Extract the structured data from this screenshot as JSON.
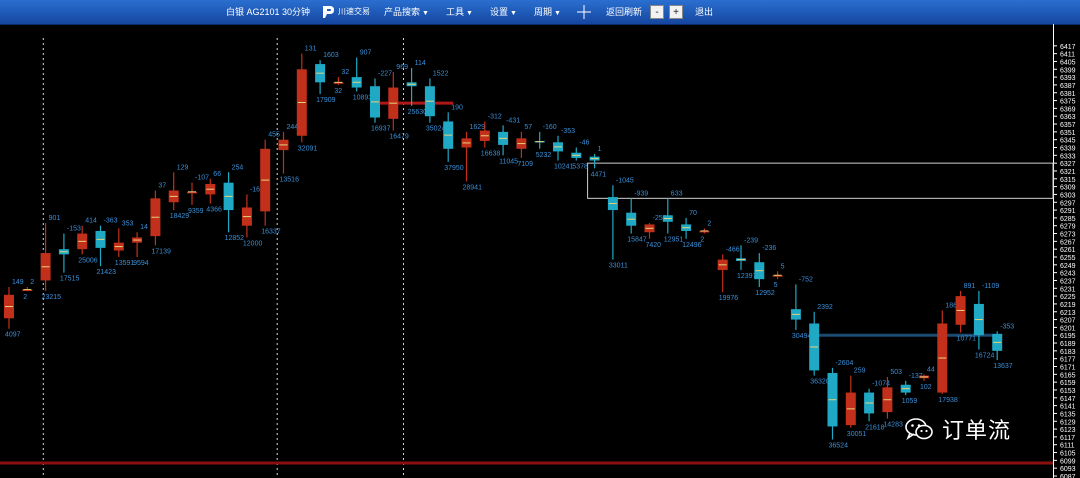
{
  "toolbar": {
    "title": "白银 AG2101 30分钟",
    "logo_text": "川速交易",
    "product_search": "产品搜索",
    "tools": "工具",
    "settings": "设置",
    "period": "周期",
    "back_refresh": "返回刷新",
    "minus_label": "-",
    "plus_label": "+",
    "exit": "退出",
    "icons": {
      "dropdown": "chevron-down-icon",
      "crosshair": "crosshair-icon",
      "logo": "logo-icon"
    }
  },
  "watermark": {
    "text": "订单流",
    "icon": "wechat-icon"
  },
  "colors": {
    "background": "#000000",
    "toolbar": "#1f5cc0",
    "up_candle": "#c2301c",
    "down_candle": "#1fa9c4",
    "label": "#3a8fd8",
    "guide": "#8a1010"
  },
  "chart_data": {
    "type": "candlestick",
    "symbol": "AG2101",
    "period": "30分钟",
    "ylim": [
      6087,
      6423
    ],
    "y_ticks": [
      6417,
      6411,
      6405,
      6399,
      6393,
      6387,
      6381,
      6375,
      6369,
      6363,
      6357,
      6351,
      6345,
      6339,
      6333,
      6327,
      6321,
      6315,
      6309,
      6303,
      6297,
      6291,
      6285,
      6279,
      6273,
      6267,
      6261,
      6255,
      6249,
      6243,
      6237,
      6231,
      6225,
      6219,
      6213,
      6207,
      6201,
      6195,
      6189,
      6183,
      6177,
      6171,
      6165,
      6159,
      6153,
      6147,
      6141,
      6135,
      6129,
      6123,
      6117,
      6111,
      6105,
      6099,
      6093,
      6087
    ],
    "session_separators": [
      1,
      14,
      15
    ],
    "candles": [
      {
        "o": 6208,
        "h": 6232,
        "l": 6200,
        "c": 6226,
        "delta": "149",
        "vol": "4097"
      },
      {
        "o": 6230,
        "h": 6232,
        "l": 6229,
        "c": 6230,
        "delta": "2",
        "vol": "2"
      },
      {
        "o": 6237,
        "h": 6281,
        "l": 6229,
        "c": 6258,
        "delta": "901",
        "vol": "23215"
      },
      {
        "o": 6261,
        "h": 6273,
        "l": 6243,
        "c": 6257,
        "delta": "-153",
        "vol": "17515"
      },
      {
        "o": 6261,
        "h": 6279,
        "l": 6257,
        "c": 6273,
        "delta": "414",
        "vol": "25006"
      },
      {
        "o": 6275,
        "h": 6279,
        "l": 6248,
        "c": 6262,
        "delta": "-363",
        "vol": "21423"
      },
      {
        "o": 6260,
        "h": 6277,
        "l": 6255,
        "c": 6266,
        "delta": "353",
        "vol": "13591"
      },
      {
        "o": 6266,
        "h": 6274,
        "l": 6255,
        "c": 6270,
        "delta": "14",
        "vol": "9594"
      },
      {
        "o": 6271,
        "h": 6306,
        "l": 6264,
        "c": 6300,
        "delta": "37",
        "vol": "17139"
      },
      {
        "o": 6297,
        "h": 6320,
        "l": 6291,
        "c": 6306,
        "delta": "129",
        "vol": "18429"
      },
      {
        "o": 6305,
        "h": 6312,
        "l": 6295,
        "c": 6305,
        "delta": "-107",
        "vol": "9359"
      },
      {
        "o": 6303,
        "h": 6315,
        "l": 6296,
        "c": 6311,
        "delta": "66",
        "vol": "4366"
      },
      {
        "o": 6312,
        "h": 6320,
        "l": 6274,
        "c": 6291,
        "delta": "254",
        "vol": "12852"
      },
      {
        "o": 6279,
        "h": 6303,
        "l": 6270,
        "c": 6293,
        "delta": "-162",
        "vol": "12000"
      },
      {
        "o": 6290,
        "h": 6345,
        "l": 6279,
        "c": 6338,
        "delta": "455",
        "vol": "16337"
      },
      {
        "o": 6337,
        "h": 6351,
        "l": 6319,
        "c": 6345,
        "delta": "244",
        "vol": "13516"
      },
      {
        "o": 6348,
        "h": 6411,
        "l": 6343,
        "c": 6399,
        "delta": "131",
        "vol": "32091"
      },
      {
        "o": 6403,
        "h": 6406,
        "l": 6380,
        "c": 6389,
        "delta": "1603",
        "vol": "17909"
      },
      {
        "o": 6389,
        "h": 6393,
        "l": 6387,
        "c": 6389,
        "delta": "32",
        "vol": "32"
      },
      {
        "o": 6393,
        "h": 6408,
        "l": 6382,
        "c": 6385,
        "delta": "907",
        "vol": "10893"
      },
      {
        "o": 6386,
        "h": 6392,
        "l": 6358,
        "c": 6362,
        "delta": "-227",
        "vol": "16937"
      },
      {
        "o": 6361,
        "h": 6397,
        "l": 6352,
        "c": 6385,
        "delta": "969",
        "vol": "16479"
      },
      {
        "o": 6389,
        "h": 6400,
        "l": 6371,
        "c": 6386,
        "delta": "114",
        "vol": "25630"
      },
      {
        "o": 6386,
        "h": 6392,
        "l": 6358,
        "c": 6363,
        "delta": "1522",
        "vol": "35024"
      },
      {
        "o": 6359,
        "h": 6366,
        "l": 6328,
        "c": 6338,
        "delta": "190",
        "vol": "37950"
      },
      {
        "o": 6339,
        "h": 6351,
        "l": 6313,
        "c": 6346,
        "delta": "1629",
        "vol": "28941"
      },
      {
        "o": 6344,
        "h": 6359,
        "l": 6339,
        "c": 6352,
        "delta": "-312",
        "vol": "16638"
      },
      {
        "o": 6351,
        "h": 6356,
        "l": 6333,
        "c": 6341,
        "delta": "-431",
        "vol": "11045"
      },
      {
        "o": 6338,
        "h": 6351,
        "l": 6331,
        "c": 6346,
        "delta": "57",
        "vol": "7109"
      },
      {
        "o": 6344,
        "h": 6351,
        "l": 6338,
        "c": 6343,
        "delta": "-160",
        "vol": "5232"
      },
      {
        "o": 6343,
        "h": 6348,
        "l": 6329,
        "c": 6336,
        "delta": "-353",
        "vol": "10241"
      },
      {
        "o": 6335,
        "h": 6339,
        "l": 6329,
        "c": 6331,
        "delta": "-46",
        "vol": "5378"
      },
      {
        "o": 6332,
        "h": 6334,
        "l": 6323,
        "c": 6329,
        "delta": "1",
        "vol": "4471"
      },
      {
        "o": 6301,
        "h": 6310,
        "l": 6253,
        "c": 6291,
        "delta": "-1045",
        "vol": "33011"
      },
      {
        "o": 6289,
        "h": 6300,
        "l": 6273,
        "c": 6279,
        "delta": "-939",
        "vol": "15847"
      },
      {
        "o": 6274,
        "h": 6281,
        "l": 6269,
        "c": 6280,
        "delta": "-256",
        "vol": "7420"
      },
      {
        "o": 6287,
        "h": 6300,
        "l": 6273,
        "c": 6282,
        "delta": "633",
        "vol": "12951"
      },
      {
        "o": 6280,
        "h": 6285,
        "l": 6269,
        "c": 6275,
        "delta": "70",
        "vol": "12496"
      },
      {
        "o": 6275,
        "h": 6277,
        "l": 6273,
        "c": 6275,
        "delta": "2",
        "vol": "2"
      },
      {
        "o": 6245,
        "h": 6257,
        "l": 6228,
        "c": 6253,
        "delta": "-466",
        "vol": "19976"
      },
      {
        "o": 6254,
        "h": 6264,
        "l": 6245,
        "c": 6252,
        "delta": "-239",
        "vol": "12397"
      },
      {
        "o": 6251,
        "h": 6258,
        "l": 6232,
        "c": 6238,
        "delta": "-236",
        "vol": "12952"
      },
      {
        "o": 6241,
        "h": 6244,
        "l": 6238,
        "c": 6241,
        "delta": "5",
        "vol": "5"
      },
      {
        "o": 6215,
        "h": 6234,
        "l": 6199,
        "c": 6207,
        "delta": "-752",
        "vol": "30494"
      },
      {
        "o": 6204,
        "h": 6213,
        "l": 6164,
        "c": 6168,
        "delta": "2392",
        "vol": "36320"
      },
      {
        "o": 6166,
        "h": 6170,
        "l": 6115,
        "c": 6125,
        "delta": "-2604",
        "vol": "36524"
      },
      {
        "o": 6126,
        "h": 6164,
        "l": 6124,
        "c": 6151,
        "delta": "259",
        "vol": "30051"
      },
      {
        "o": 6151,
        "h": 6154,
        "l": 6129,
        "c": 6135,
        "delta": "-1074",
        "vol": "21618"
      },
      {
        "o": 6136,
        "h": 6163,
        "l": 6131,
        "c": 6155,
        "delta": "503",
        "vol": "14283"
      },
      {
        "o": 6157,
        "h": 6160,
        "l": 6149,
        "c": 6151,
        "delta": "-137",
        "vol": "1059"
      },
      {
        "o": 6162,
        "h": 6165,
        "l": 6160,
        "c": 6164,
        "delta": "44",
        "vol": "102"
      },
      {
        "o": 6151,
        "h": 6214,
        "l": 6150,
        "c": 6204,
        "delta": "186",
        "vol": "17938"
      },
      {
        "o": 6203,
        "h": 6229,
        "l": 6197,
        "c": 6225,
        "delta": "891",
        "vol": "10771"
      },
      {
        "o": 6219,
        "h": 6229,
        "l": 6184,
        "c": 6195,
        "delta": "-1109",
        "vol": "16724"
      },
      {
        "o": 6196,
        "h": 6198,
        "l": 6176,
        "c": 6183,
        "delta": "-353",
        "vol": "13637"
      }
    ],
    "annotations": {
      "h_line_red": {
        "y": 6373,
        "from": 20,
        "to": 24
      },
      "h_line_teal": {
        "y": 6195,
        "from": 44,
        "to": 54
      },
      "h_line_bottom": {
        "y": 6097
      },
      "rectangle": {
        "y_top": 6327,
        "y_bottom": 6300,
        "from": 32
      }
    }
  }
}
